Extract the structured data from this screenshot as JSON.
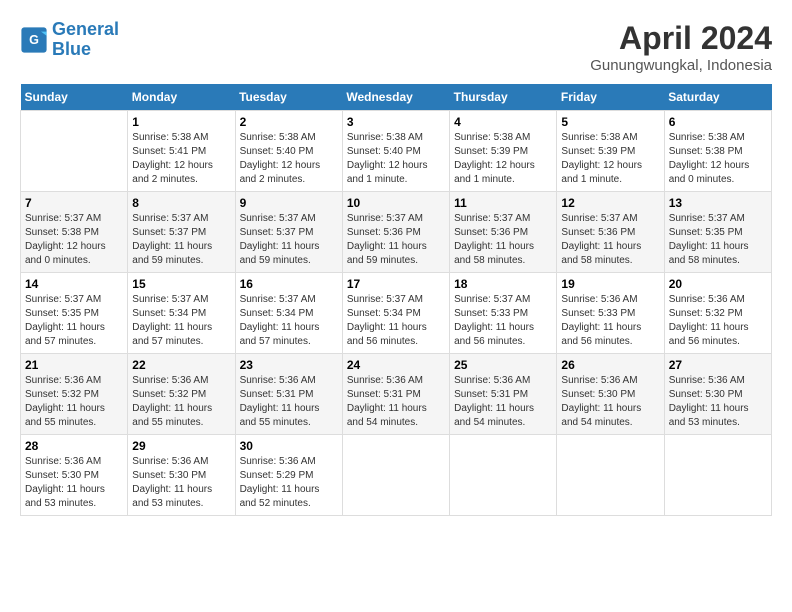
{
  "logo": {
    "line1": "General",
    "line2": "Blue"
  },
  "title": "April 2024",
  "location": "Gunungwungkal, Indonesia",
  "days_of_week": [
    "Sunday",
    "Monday",
    "Tuesday",
    "Wednesday",
    "Thursday",
    "Friday",
    "Saturday"
  ],
  "weeks": [
    [
      {
        "day": "",
        "info": ""
      },
      {
        "day": "1",
        "info": "Sunrise: 5:38 AM\nSunset: 5:41 PM\nDaylight: 12 hours\nand 2 minutes."
      },
      {
        "day": "2",
        "info": "Sunrise: 5:38 AM\nSunset: 5:40 PM\nDaylight: 12 hours\nand 2 minutes."
      },
      {
        "day": "3",
        "info": "Sunrise: 5:38 AM\nSunset: 5:40 PM\nDaylight: 12 hours\nand 1 minute."
      },
      {
        "day": "4",
        "info": "Sunrise: 5:38 AM\nSunset: 5:39 PM\nDaylight: 12 hours\nand 1 minute."
      },
      {
        "day": "5",
        "info": "Sunrise: 5:38 AM\nSunset: 5:39 PM\nDaylight: 12 hours\nand 1 minute."
      },
      {
        "day": "6",
        "info": "Sunrise: 5:38 AM\nSunset: 5:38 PM\nDaylight: 12 hours\nand 0 minutes."
      }
    ],
    [
      {
        "day": "7",
        "info": "Sunrise: 5:37 AM\nSunset: 5:38 PM\nDaylight: 12 hours\nand 0 minutes."
      },
      {
        "day": "8",
        "info": "Sunrise: 5:37 AM\nSunset: 5:37 PM\nDaylight: 11 hours\nand 59 minutes."
      },
      {
        "day": "9",
        "info": "Sunrise: 5:37 AM\nSunset: 5:37 PM\nDaylight: 11 hours\nand 59 minutes."
      },
      {
        "day": "10",
        "info": "Sunrise: 5:37 AM\nSunset: 5:36 PM\nDaylight: 11 hours\nand 59 minutes."
      },
      {
        "day": "11",
        "info": "Sunrise: 5:37 AM\nSunset: 5:36 PM\nDaylight: 11 hours\nand 58 minutes."
      },
      {
        "day": "12",
        "info": "Sunrise: 5:37 AM\nSunset: 5:36 PM\nDaylight: 11 hours\nand 58 minutes."
      },
      {
        "day": "13",
        "info": "Sunrise: 5:37 AM\nSunset: 5:35 PM\nDaylight: 11 hours\nand 58 minutes."
      }
    ],
    [
      {
        "day": "14",
        "info": "Sunrise: 5:37 AM\nSunset: 5:35 PM\nDaylight: 11 hours\nand 57 minutes."
      },
      {
        "day": "15",
        "info": "Sunrise: 5:37 AM\nSunset: 5:34 PM\nDaylight: 11 hours\nand 57 minutes."
      },
      {
        "day": "16",
        "info": "Sunrise: 5:37 AM\nSunset: 5:34 PM\nDaylight: 11 hours\nand 57 minutes."
      },
      {
        "day": "17",
        "info": "Sunrise: 5:37 AM\nSunset: 5:34 PM\nDaylight: 11 hours\nand 56 minutes."
      },
      {
        "day": "18",
        "info": "Sunrise: 5:37 AM\nSunset: 5:33 PM\nDaylight: 11 hours\nand 56 minutes."
      },
      {
        "day": "19",
        "info": "Sunrise: 5:36 AM\nSunset: 5:33 PM\nDaylight: 11 hours\nand 56 minutes."
      },
      {
        "day": "20",
        "info": "Sunrise: 5:36 AM\nSunset: 5:32 PM\nDaylight: 11 hours\nand 56 minutes."
      }
    ],
    [
      {
        "day": "21",
        "info": "Sunrise: 5:36 AM\nSunset: 5:32 PM\nDaylight: 11 hours\nand 55 minutes."
      },
      {
        "day": "22",
        "info": "Sunrise: 5:36 AM\nSunset: 5:32 PM\nDaylight: 11 hours\nand 55 minutes."
      },
      {
        "day": "23",
        "info": "Sunrise: 5:36 AM\nSunset: 5:31 PM\nDaylight: 11 hours\nand 55 minutes."
      },
      {
        "day": "24",
        "info": "Sunrise: 5:36 AM\nSunset: 5:31 PM\nDaylight: 11 hours\nand 54 minutes."
      },
      {
        "day": "25",
        "info": "Sunrise: 5:36 AM\nSunset: 5:31 PM\nDaylight: 11 hours\nand 54 minutes."
      },
      {
        "day": "26",
        "info": "Sunrise: 5:36 AM\nSunset: 5:30 PM\nDaylight: 11 hours\nand 54 minutes."
      },
      {
        "day": "27",
        "info": "Sunrise: 5:36 AM\nSunset: 5:30 PM\nDaylight: 11 hours\nand 53 minutes."
      }
    ],
    [
      {
        "day": "28",
        "info": "Sunrise: 5:36 AM\nSunset: 5:30 PM\nDaylight: 11 hours\nand 53 minutes."
      },
      {
        "day": "29",
        "info": "Sunrise: 5:36 AM\nSunset: 5:30 PM\nDaylight: 11 hours\nand 53 minutes."
      },
      {
        "day": "30",
        "info": "Sunrise: 5:36 AM\nSunset: 5:29 PM\nDaylight: 11 hours\nand 52 minutes."
      },
      {
        "day": "",
        "info": ""
      },
      {
        "day": "",
        "info": ""
      },
      {
        "day": "",
        "info": ""
      },
      {
        "day": "",
        "info": ""
      }
    ]
  ]
}
